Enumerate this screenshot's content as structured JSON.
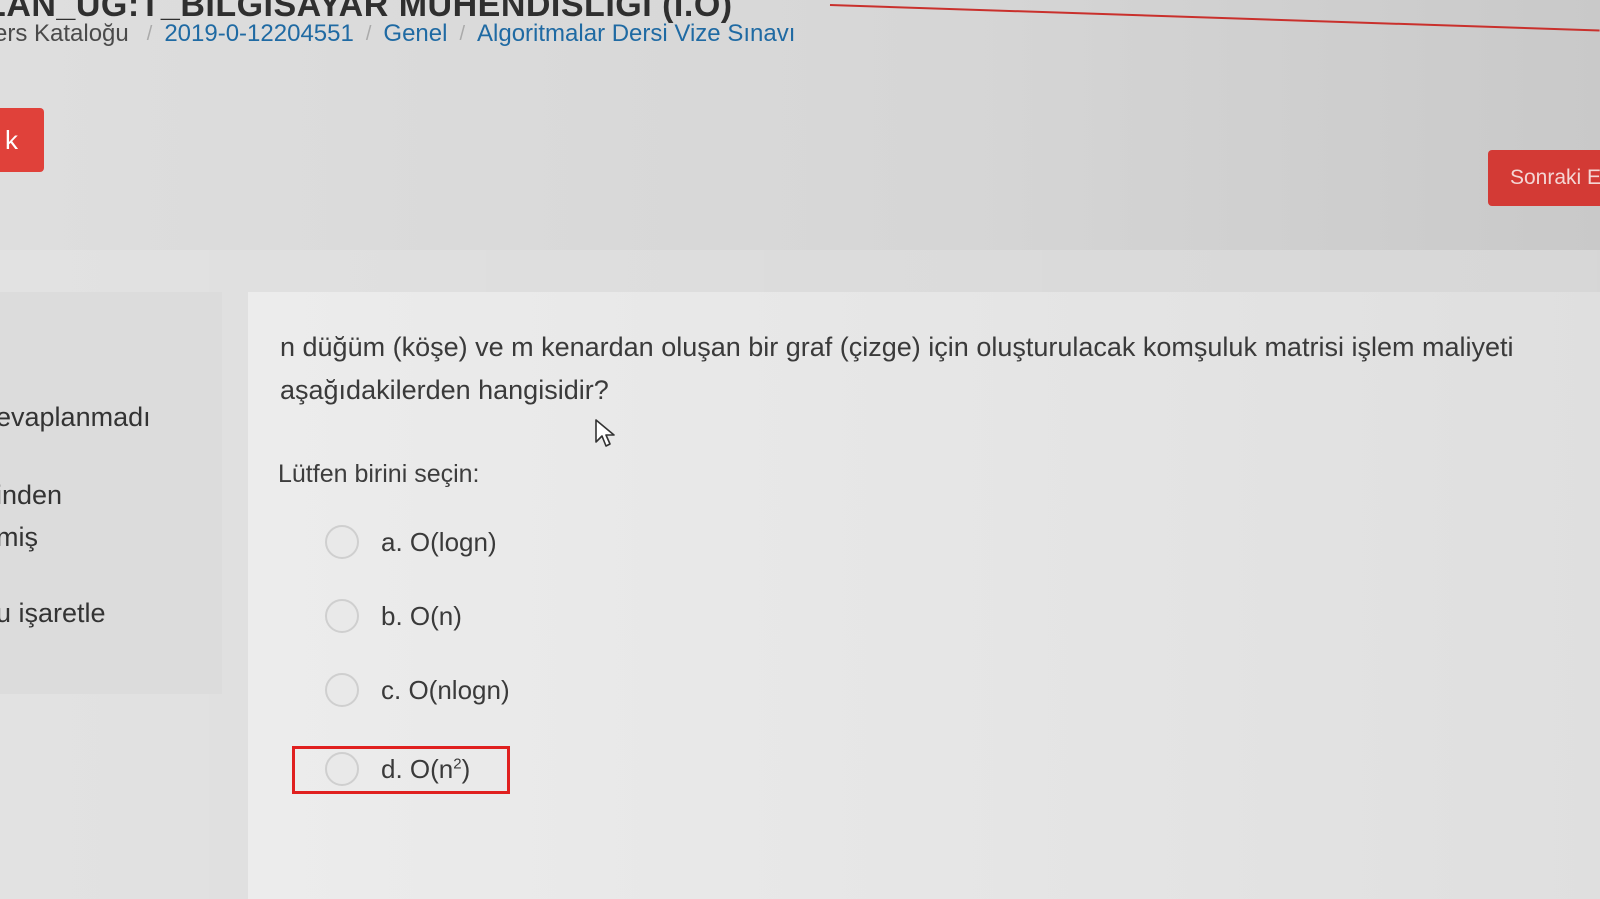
{
  "header": {
    "course_title": "ALAN_UG:T_BILGISAYAR MUHENDISLIGI (I.O)",
    "breadcrumb": [
      "ers Kataloğu",
      "2019-0-12204551",
      "Genel",
      "Algoritmalar Dersi Vize Sınavı"
    ],
    "breadcrumb_separator": "/"
  },
  "nav": {
    "back_label": "k",
    "next_label": "Sonraki E"
  },
  "question_info": {
    "status": "evaplanmadı",
    "grade_line1": "inden",
    "grade_line2": "miş",
    "flag_label": "u işaretle"
  },
  "question": {
    "text": "n düğüm (köşe) ve m kenardan oluşan bir graf (çizge) için oluşturulacak komşuluk matrisi işlem maliyeti aşağıdakilerden hangisidir?",
    "prompt": "Lütfen birini seçin:",
    "options": {
      "a": "a. O(logn)",
      "b": "b. O(n)",
      "c": "c. O(nlogn)",
      "d_prefix": "d. O(n",
      "d_sup": "2",
      "d_suffix": ")"
    }
  },
  "colors": {
    "accent_red": "#d33a35",
    "highlight_red": "#e0201f",
    "link_blue": "#1f6aa3"
  },
  "icons": {
    "cursor": "mouse-pointer-icon",
    "radio": "radio-circle"
  }
}
